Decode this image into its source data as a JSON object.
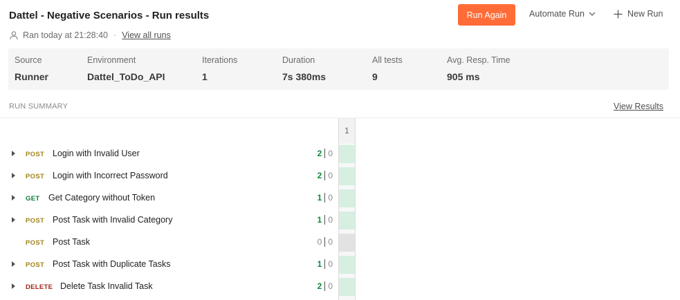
{
  "header": {
    "title": "Dattel - Negative Scenarios - Run results",
    "run_time": "Ran today at 21:28:40",
    "separator": "·",
    "view_all_runs": "View all runs",
    "run_again": "Run Again",
    "automate_run": "Automate Run",
    "new_run": "New Run"
  },
  "stats": [
    {
      "label": "Source",
      "value": "Runner"
    },
    {
      "label": "Environment",
      "value": "Dattel_ToDo_API"
    },
    {
      "label": "Iterations",
      "value": "1"
    },
    {
      "label": "Duration",
      "value": "7s 380ms"
    },
    {
      "label": "All tests",
      "value": "9"
    },
    {
      "label": "Avg. Resp. Time",
      "value": "905 ms"
    }
  ],
  "summary": {
    "title": "RUN SUMMARY",
    "view_results": "View Results",
    "iteration_header": "1"
  },
  "requests": [
    {
      "method": "POST",
      "name": "Login with Invalid User",
      "passed": "2",
      "failed": "0",
      "expandable": true,
      "status": "pass"
    },
    {
      "method": "POST",
      "name": "Login with Incorrect Password",
      "passed": "2",
      "failed": "0",
      "expandable": true,
      "status": "pass"
    },
    {
      "method": "GET",
      "name": "Get Category without Token",
      "passed": "1",
      "failed": "0",
      "expandable": true,
      "status": "pass"
    },
    {
      "method": "POST",
      "name": "Post Task with Invalid Category",
      "passed": "1",
      "failed": "0",
      "expandable": true,
      "status": "pass"
    },
    {
      "method": "POST",
      "name": "Post Task",
      "passed": "0",
      "failed": "0",
      "expandable": false,
      "status": "none"
    },
    {
      "method": "POST",
      "name": "Post Task with Duplicate Tasks",
      "passed": "1",
      "failed": "0",
      "expandable": true,
      "status": "pass"
    },
    {
      "method": "DELETE",
      "name": "Delete Task Invalid Task",
      "passed": "2",
      "failed": "0",
      "expandable": true,
      "status": "pass"
    }
  ],
  "colors": {
    "accent": "#ff6c37",
    "POST": "#a0841a",
    "GET": "#0a7a3a",
    "DELETE": "#a3261b",
    "pass_cell": "#d6efe0",
    "none_cell": "#e2e2e2"
  }
}
